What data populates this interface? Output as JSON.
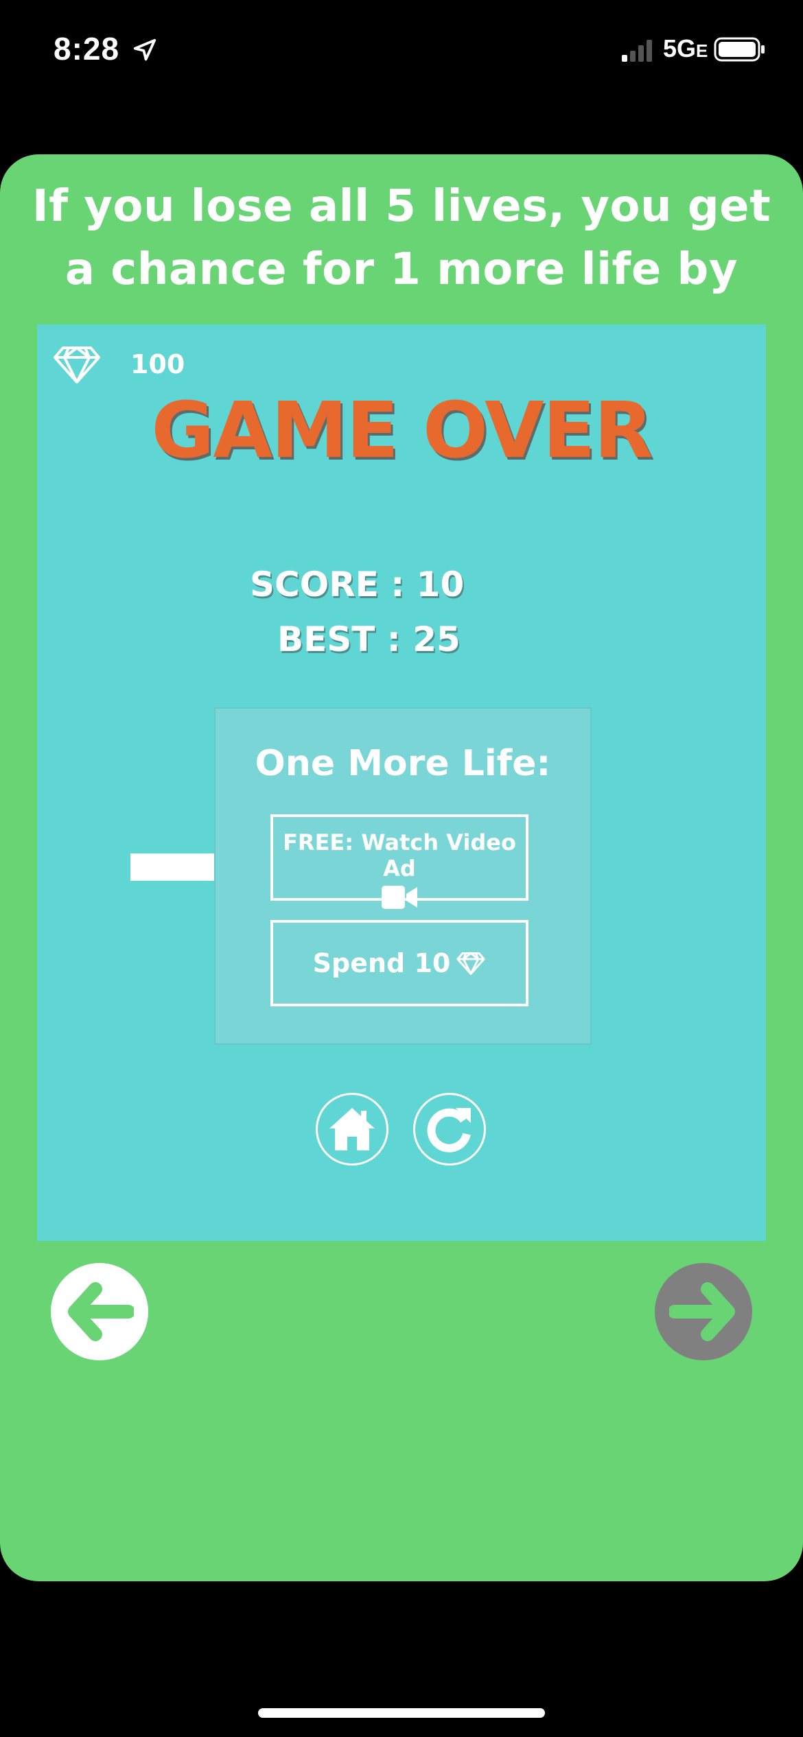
{
  "status_bar": {
    "time": "8:28",
    "network": "5G",
    "network_suffix": "E"
  },
  "tutorial": {
    "text": "If you lose all 5 lives, you get a chance for 1 more life by"
  },
  "game": {
    "gem_count": "100",
    "title": "GAME OVER",
    "score": "SCORE : 10",
    "best": "BEST : 25",
    "one_more_life": {
      "title": "One More Life:",
      "video_label": "FREE: Watch Video Ad",
      "spend_label": "Spend 10"
    }
  },
  "colors": {
    "card_green": "#68d474",
    "panel_cyan": "#60d6d4",
    "title_orange": "#e8692e",
    "next_disabled_gray": "#808080"
  },
  "icons": {
    "gem": "diamond-icon",
    "video": "video-camera-icon",
    "home": "home-icon",
    "replay": "replay-icon",
    "back": "arrow-left-icon",
    "next": "arrow-right-icon",
    "pointer": "pointer-arrow-icon"
  }
}
